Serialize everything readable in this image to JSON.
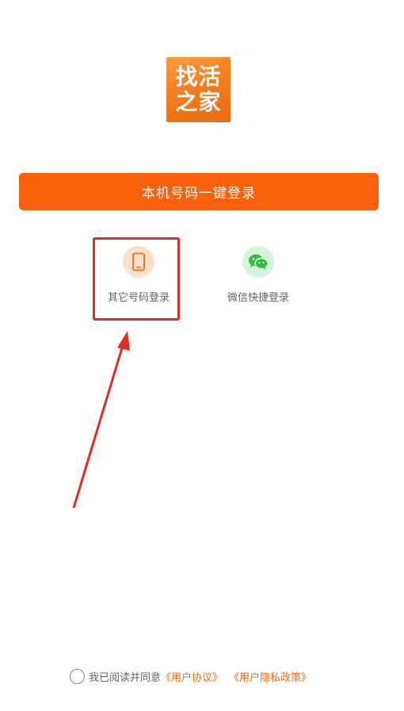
{
  "logo": {
    "line1": "找活",
    "line2": "之家"
  },
  "primary_login": {
    "label": "本机号码一键登录"
  },
  "options": {
    "other_phone_label": "其它号码登录",
    "wechat_label": "微信快捷登录"
  },
  "agreement": {
    "prefix": "我已阅读并同意",
    "user_agreement": "《用户协议》",
    "privacy_policy": "《用户隐私政策》"
  },
  "colors": {
    "brand_orange": "#f8600a",
    "link_orange": "#f06a16",
    "annotation_red": "#e32b22",
    "wechat_green": "#2fbe45"
  },
  "icons": {
    "phone": "mobile-phone-icon",
    "wechat": "wechat-icon"
  }
}
